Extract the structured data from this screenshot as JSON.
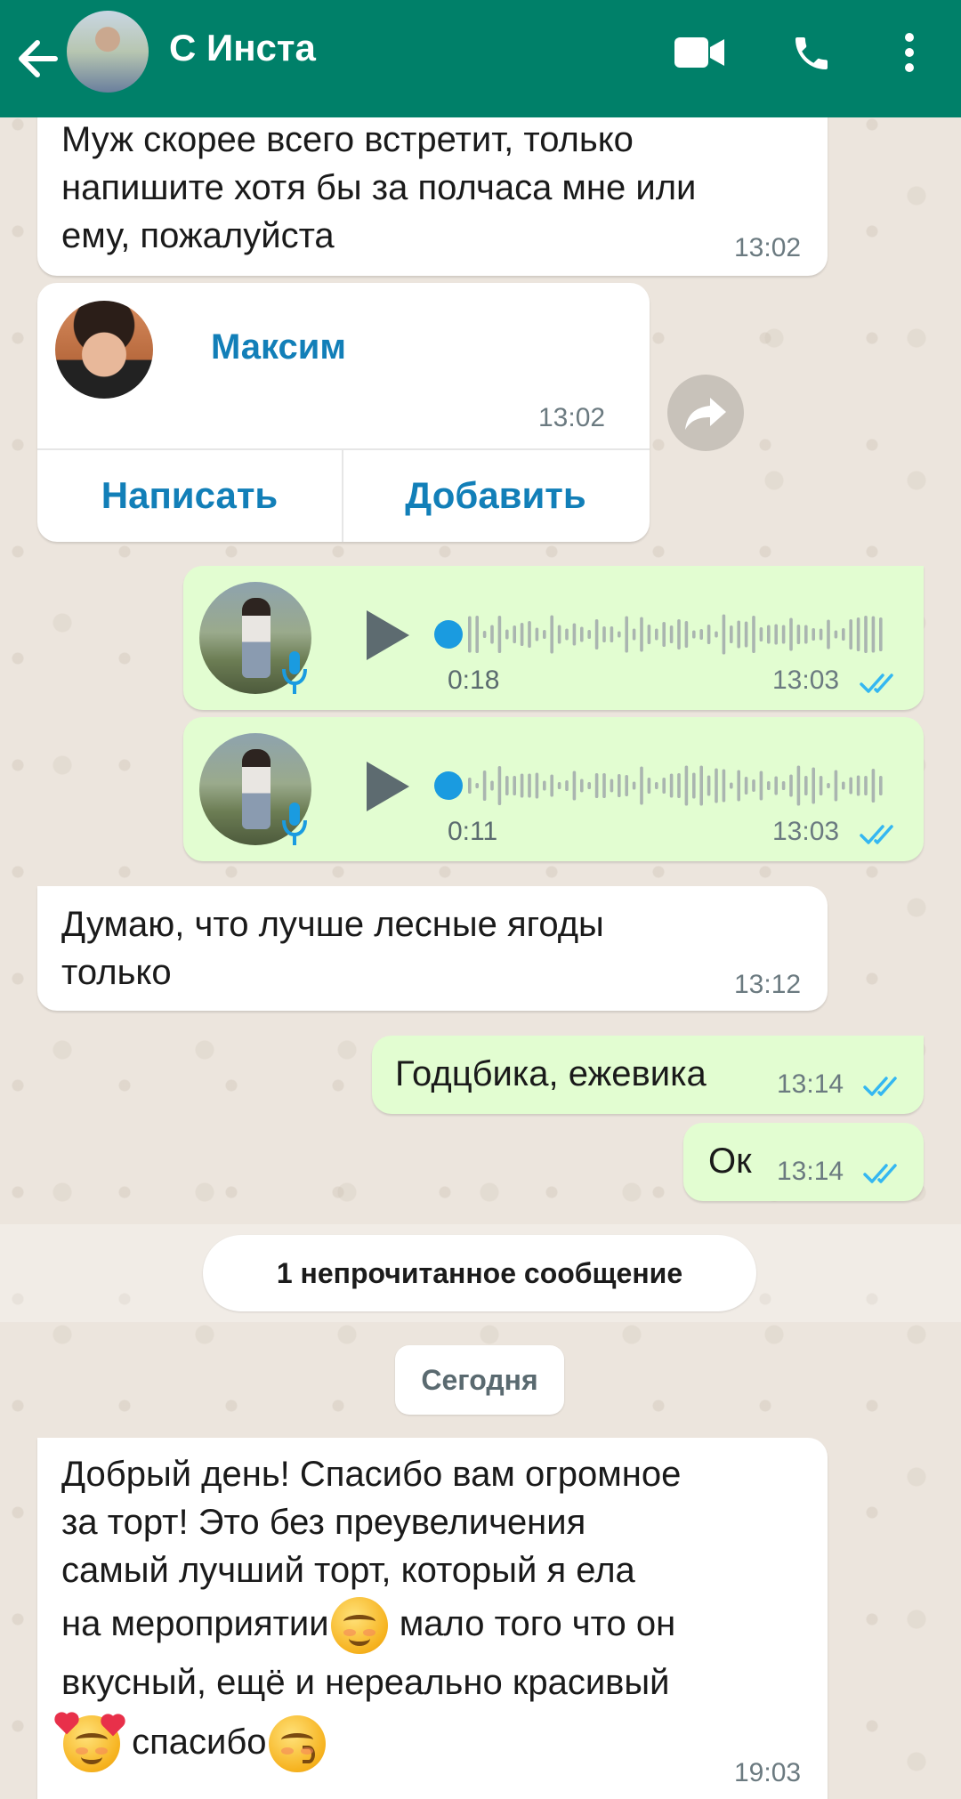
{
  "header": {
    "title": "С Инста",
    "icons": [
      "back-arrow-icon",
      "video-call-icon",
      "phone-icon",
      "more-options-icon"
    ],
    "bg_color": "#008069"
  },
  "messages": {
    "m1": {
      "lines": [
        "Муж скорее всего встретит, только",
        "напишите хотя бы за полчаса мне или",
        "ему, пожалуйста"
      ],
      "time": "13:02"
    },
    "contact": {
      "name": "Максим",
      "time": "13:02",
      "write_label": "Написать",
      "add_label": "Добавить"
    },
    "voice1": {
      "duration": "0:18",
      "time": "13:03"
    },
    "voice2": {
      "duration": "0:11",
      "time": "13:03"
    },
    "m2": {
      "lines": [
        "Думаю, что лучше лесные ягоды",
        "только"
      ],
      "time": "13:12"
    },
    "m3": {
      "text": "Годцбика, ежевика",
      "time": "13:14"
    },
    "m4": {
      "text": "Ок",
      "time": "13:14"
    },
    "unread": "1 непрочитанное сообщение",
    "date": "Сегодня",
    "m5": {
      "l1": "Добрый день! Спасибо вам огромное",
      "l2": "за торт! Это без преувеличения",
      "l3": "самый лучший торт, который я ела",
      "l4a": "на мероприятии",
      "l4b": " мало того что он",
      "l5": "вкусный, ещё и нереально красивый",
      "l6": " спасибо",
      "time": "19:03"
    }
  },
  "colors": {
    "outgoing": "#e2fdd1",
    "link": "#127fb8",
    "read_ticks": "#34b7f1"
  }
}
